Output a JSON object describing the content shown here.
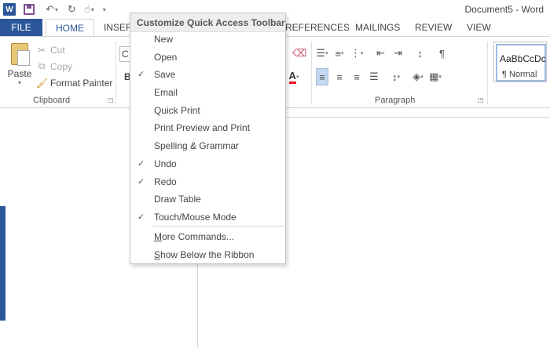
{
  "window": {
    "title": "Document5 - Word"
  },
  "qat": {
    "app_icon": "W",
    "icons": [
      "word-app-icon",
      "save-icon",
      "undo-icon",
      "redo-icon",
      "touch-mode-icon",
      "customize-qat-icon"
    ]
  },
  "tabs": {
    "file": "FILE",
    "home": "HOME",
    "insert": "INSERT",
    "references": "REFERENCES",
    "mailings": "MAILINGS",
    "review": "REVIEW",
    "view": "VIEW"
  },
  "ribbon": {
    "clipboard": {
      "paste": "Paste",
      "cut": "Cut",
      "copy": "Copy",
      "format_painter": "Format Painter",
      "label": "Clipboard"
    },
    "font": {
      "font_box": "C",
      "bold": "B"
    },
    "paragraph": {
      "label": "Paragraph",
      "pilcrow": "¶"
    },
    "styles": {
      "sample": "AaBbCcDc",
      "normal": "¶ Normal"
    }
  },
  "menu": {
    "title": "Customize Quick Access Toolbar",
    "items": [
      {
        "label": "New",
        "checked": false
      },
      {
        "label": "Open",
        "checked": false
      },
      {
        "label": "Save",
        "checked": true
      },
      {
        "label": "Email",
        "checked": false
      },
      {
        "label": "Quick Print",
        "checked": false
      },
      {
        "label": "Print Preview and Print",
        "checked": false
      },
      {
        "label": "Spelling & Grammar",
        "checked": false
      },
      {
        "label": "Undo",
        "checked": true
      },
      {
        "label": "Redo",
        "checked": true
      },
      {
        "label": "Draw Table",
        "checked": false
      },
      {
        "label": "Touch/Mouse Mode",
        "checked": true
      }
    ],
    "more_commands": {
      "mnemonic": "M",
      "rest": "ore Commands..."
    },
    "show_below": {
      "mnemonic": "S",
      "rest": "how Below the Ribbon"
    }
  },
  "colors": {
    "accent": "#2b579a",
    "font_red": "#e81123",
    "highlight": "#c5d9f1"
  }
}
